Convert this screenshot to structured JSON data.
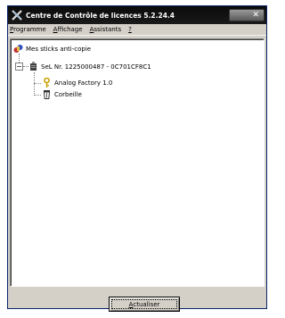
{
  "window": {
    "title": "Centre de Contrôle de licences 5.2.24.4",
    "close_glyph": "✕"
  },
  "menu": [
    {
      "first": "P",
      "rest": "rogramme"
    },
    {
      "first": "A",
      "rest": "ffichage"
    },
    {
      "first": "A",
      "rest": "ssistants"
    },
    {
      "first": "?",
      "rest": ""
    }
  ],
  "tree": {
    "root": "Mes sticks anti-copie",
    "stick": "SeL Nr. 1225000487 - 0C701CF8C1",
    "items": [
      "Analog Factory 1.0",
      "Corbeille"
    ]
  },
  "footer": {
    "refresh_first": "A",
    "refresh_rest": "ctualiser"
  },
  "colors": {
    "titlebar": "#111111",
    "face": "#d4d0c8",
    "pane": "#ffffff"
  }
}
